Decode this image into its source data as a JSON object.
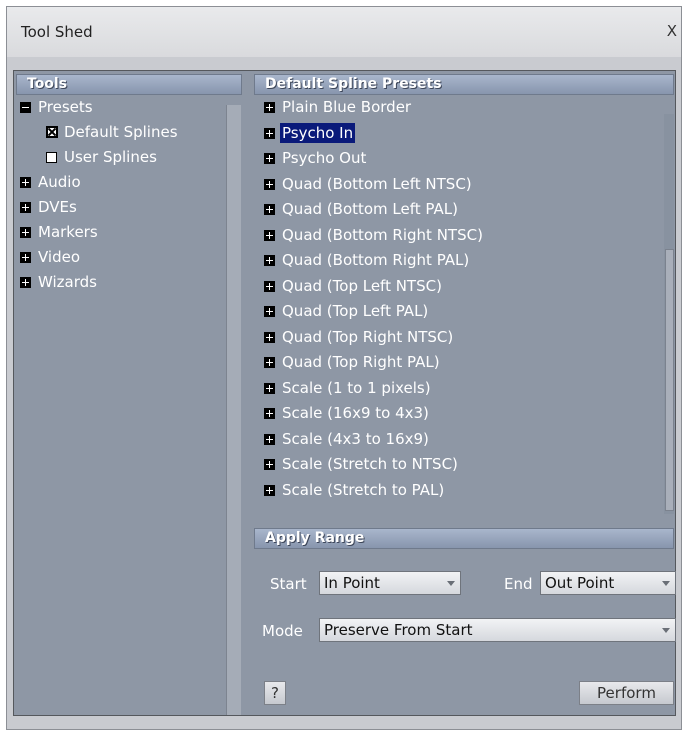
{
  "window": {
    "title": "Tool Shed",
    "close_label": "X"
  },
  "tools": {
    "header": "Tools",
    "items": [
      {
        "label": "Presets",
        "icon": "minus"
      },
      {
        "label": "Default Splines",
        "icon": "checked"
      },
      {
        "label": "User Splines",
        "icon": "unchecked"
      },
      {
        "label": "Audio",
        "icon": "plus"
      },
      {
        "label": "DVEs",
        "icon": "plus"
      },
      {
        "label": "Markers",
        "icon": "plus"
      },
      {
        "label": "Video",
        "icon": "plus"
      },
      {
        "label": "Wizards",
        "icon": "plus"
      }
    ]
  },
  "presets": {
    "header": "Default Spline Presets",
    "selected_index": 1,
    "items": [
      "Plain Blue Border",
      "Psycho In",
      "Psycho Out",
      "Quad (Bottom Left NTSC)",
      "Quad (Bottom Left PAL)",
      "Quad (Bottom Right NTSC)",
      "Quad (Bottom Right PAL)",
      "Quad (Top Left NTSC)",
      "Quad (Top Left PAL)",
      "Quad (Top Right NTSC)",
      "Quad (Top Right PAL)",
      "Scale (1 to 1 pixels)",
      "Scale (16x9 to 4x3)",
      "Scale (4x3 to 16x9)",
      "Scale (Stretch to NTSC)",
      "Scale (Stretch to PAL)"
    ]
  },
  "apply_range": {
    "header": "Apply Range",
    "start_label": "Start",
    "start_value": "In Point",
    "end_label": "End",
    "end_value": "Out Point",
    "mode_label": "Mode",
    "mode_value": "Preserve From Start"
  },
  "buttons": {
    "help": "?",
    "perform": "Perform"
  },
  "colors": {
    "panel": "#8e97a5",
    "header": "#8795ad",
    "selection": "#0a1a7a"
  }
}
